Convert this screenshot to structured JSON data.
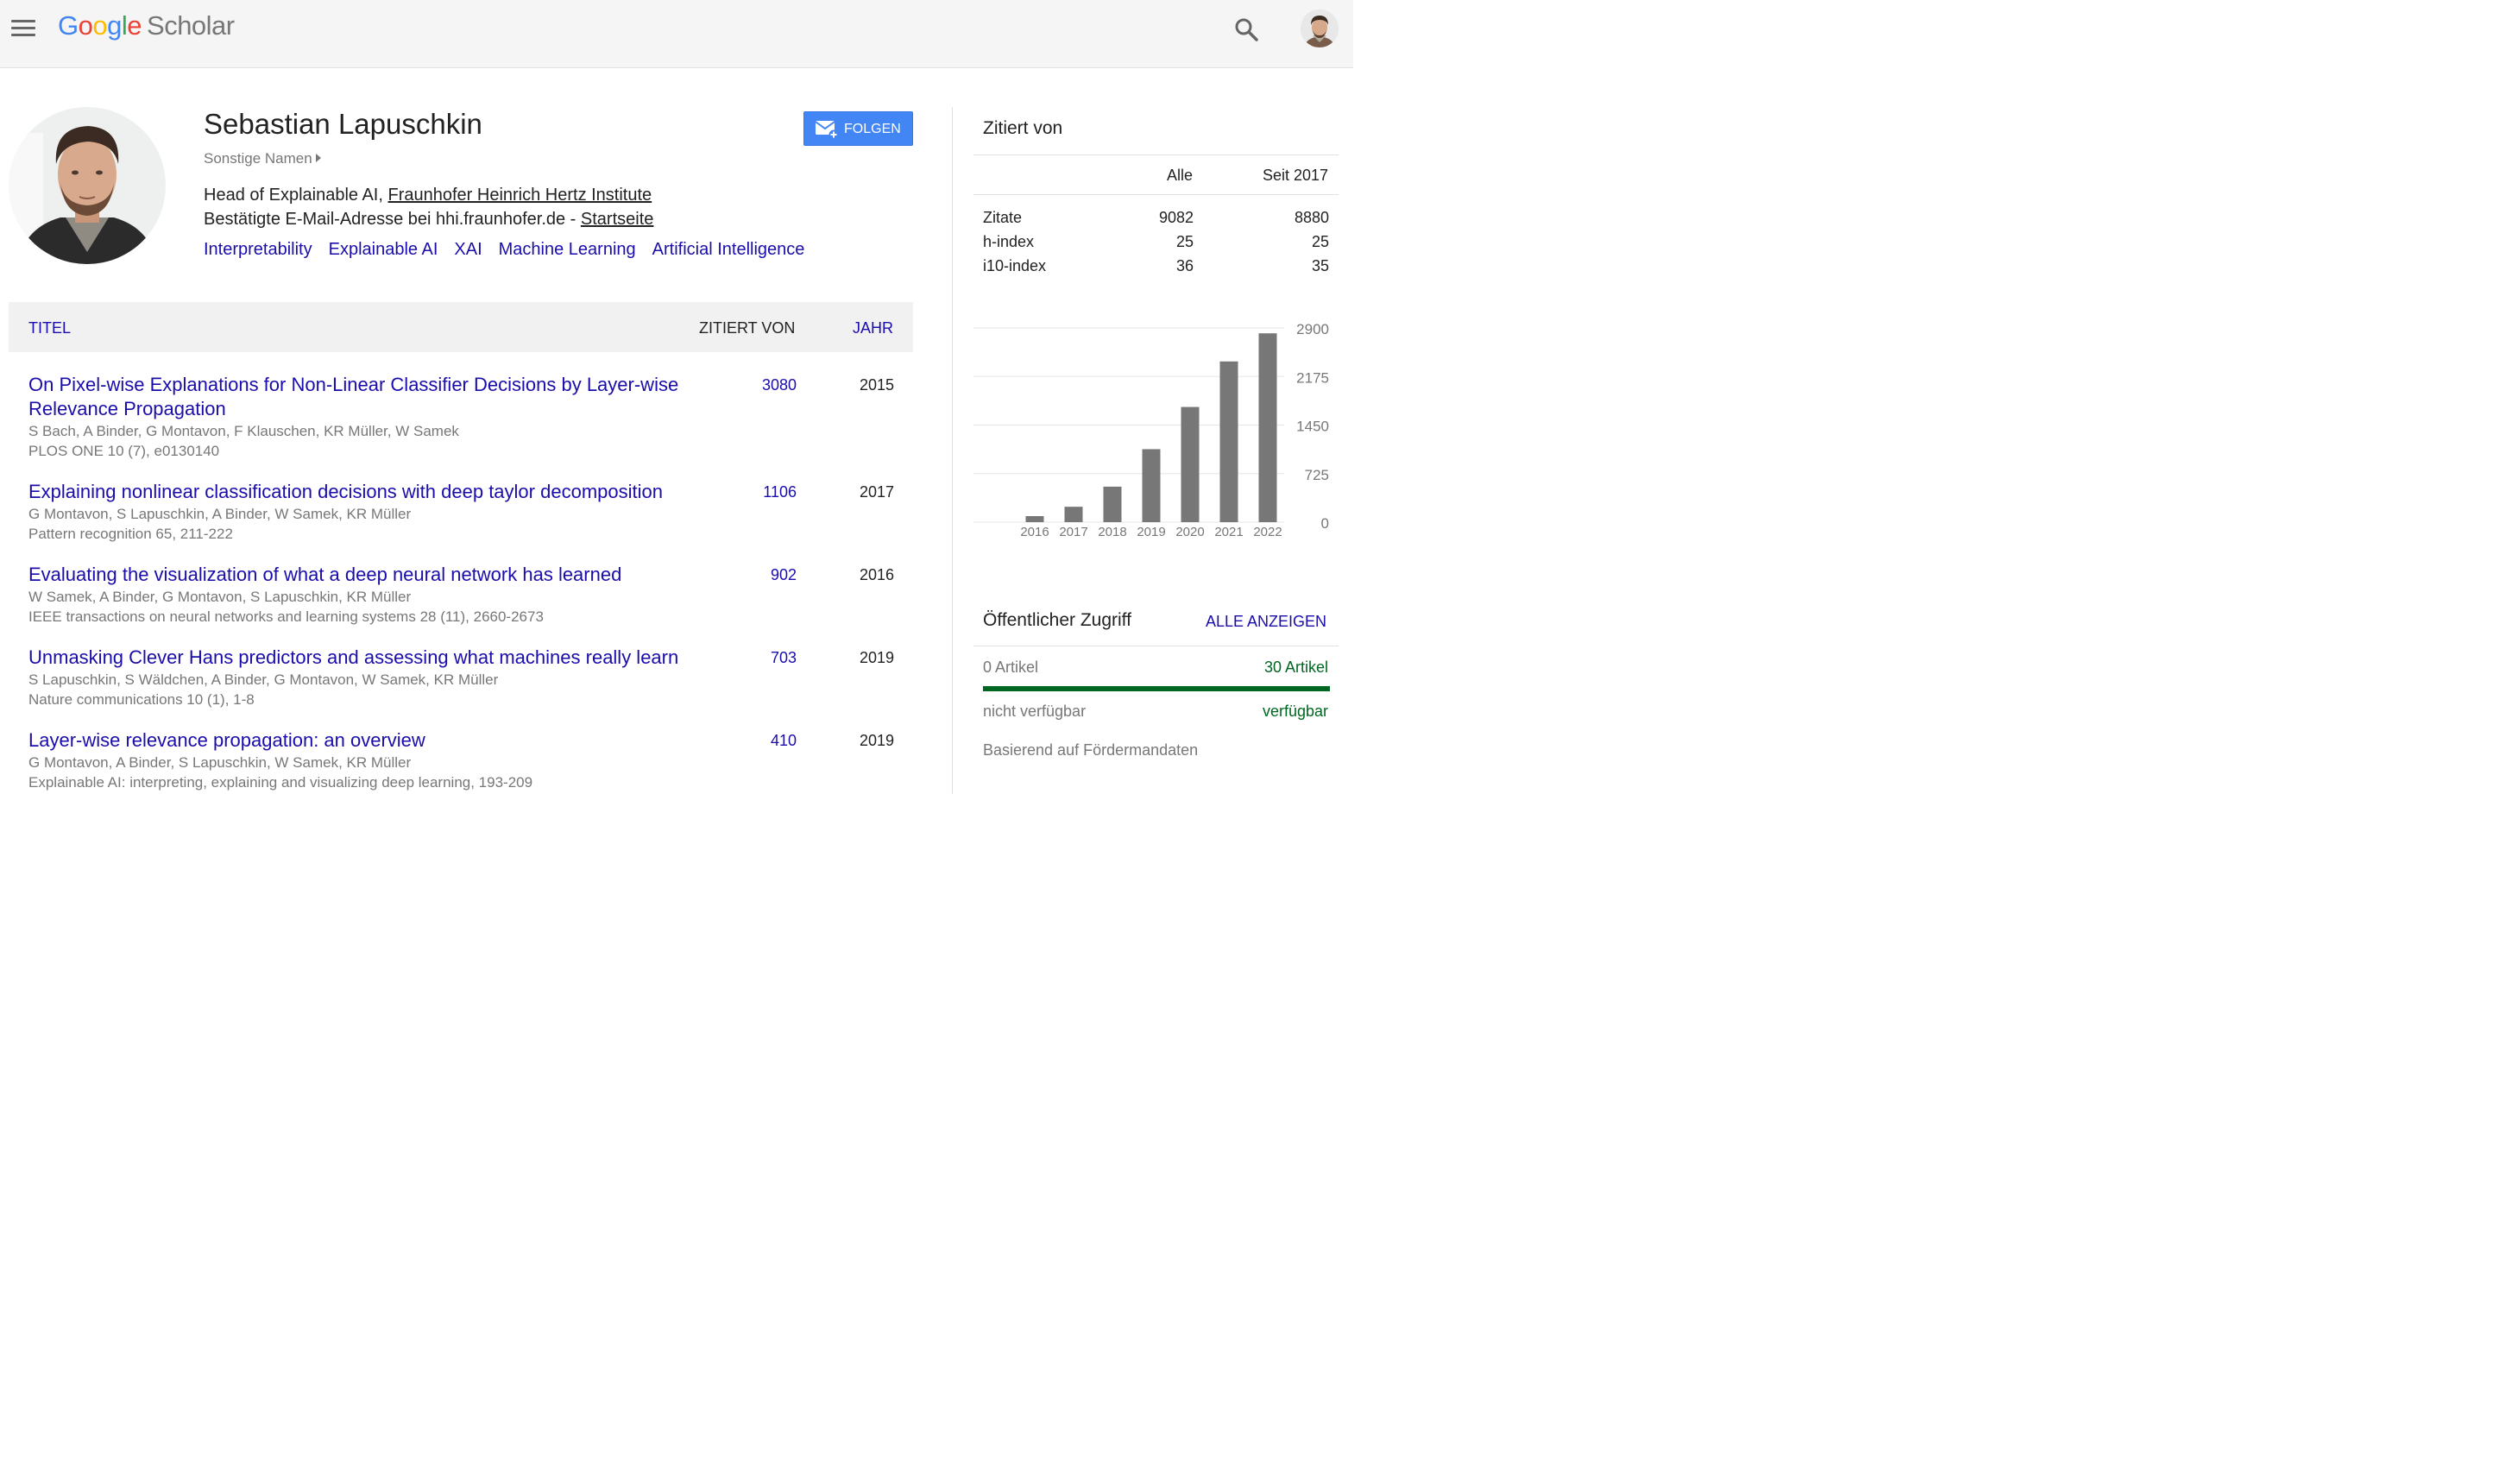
{
  "header": {
    "logo_google": [
      "G",
      "o",
      "o",
      "g",
      "l",
      "e"
    ],
    "logo_scholar": "Scholar",
    "brand_colors": [
      "#4285f4",
      "#ea4335",
      "#fbbc05",
      "#4285f4",
      "#34a853",
      "#ea4335"
    ],
    "icons": [
      "menu-icon",
      "search-icon",
      "avatar"
    ]
  },
  "profile": {
    "name": "Sebastian Lapuschkin",
    "other_names": "Sonstige Namen",
    "affiliation_prefix": "Head of Explainable AI,",
    "affiliation_link": "Fraunhofer Heinrich Hertz Institute",
    "email_text": "Bestätigte E-Mail-Adresse bei hhi.fraunhofer.de -",
    "homepage_link": "Startseite",
    "follow_label": "FOLGEN",
    "interests": [
      "Interpretability",
      "Explainable AI",
      "XAI",
      "Machine Learning",
      "Artificial Intelligence"
    ]
  },
  "table": {
    "col_title": "TITEL",
    "col_cited": "ZITIERT VON",
    "col_year": "JAHR",
    "rows": [
      {
        "title": "On Pixel-wise Explanations for Non-Linear Classifier Decisions by Layer-wise Relevance Propagation",
        "authors": "S Bach, A Binder, G Montavon, F Klauschen, KR Müller, W Samek",
        "venue": "PLOS ONE 10 (7), e0130140",
        "cites": "3080",
        "year": "2015"
      },
      {
        "title": "Explaining nonlinear classification decisions with deep taylor decomposition",
        "authors": "G Montavon, S Lapuschkin, A Binder, W Samek, KR Müller",
        "venue": "Pattern recognition 65, 211-222",
        "cites": "1106",
        "year": "2017"
      },
      {
        "title": "Evaluating the visualization of what a deep neural network has learned",
        "authors": "W Samek, A Binder, G Montavon, S Lapuschkin, KR Müller",
        "venue": "IEEE transactions on neural networks and learning systems 28 (11), 2660-2673",
        "cites": "902",
        "year": "2016"
      },
      {
        "title": "Unmasking Clever Hans predictors and assessing what machines really learn",
        "authors": "S Lapuschkin, S Wäldchen, A Binder, G Montavon, W Samek, KR Müller",
        "venue": "Nature communications 10 (1), 1-8",
        "cites": "703",
        "year": "2019"
      },
      {
        "title": "Layer-wise relevance propagation: an overview",
        "authors": "G Montavon, A Binder, S Lapuschkin, W Samek, KR Müller",
        "venue": "Explainable AI: interpreting, explaining and visualizing deep learning, 193-209",
        "cites": "410",
        "year": "2019"
      }
    ]
  },
  "cited_by": {
    "title": "Zitiert von",
    "col_all": "Alle",
    "col_since": "Seit 2017",
    "rows": [
      {
        "label": "Zitate",
        "all": "9082",
        "since": "8880"
      },
      {
        "label": "h-index",
        "all": "25",
        "since": "25"
      },
      {
        "label": "i10-index",
        "all": "36",
        "since": "35"
      }
    ]
  },
  "chart_data": {
    "type": "bar",
    "categories": [
      "2016",
      "2017",
      "2018",
      "2019",
      "2020",
      "2021",
      "2022"
    ],
    "values": [
      90,
      230,
      530,
      1090,
      1720,
      2400,
      2820
    ],
    "yticks": [
      "0",
      "725",
      "1450",
      "2175",
      "2900"
    ],
    "ylim": [
      0,
      2900
    ],
    "bar_color": "#777777",
    "grid": true
  },
  "open_access": {
    "title": "Öffentlicher Zugriff",
    "show_all": "ALLE ANZEIGEN",
    "left_count": "0 Artikel",
    "right_count": "30 Artikel",
    "left_label": "nicht verfügbar",
    "right_label": "verfügbar",
    "available_fraction": 1.0,
    "note": "Basierend auf Fördermandaten"
  }
}
